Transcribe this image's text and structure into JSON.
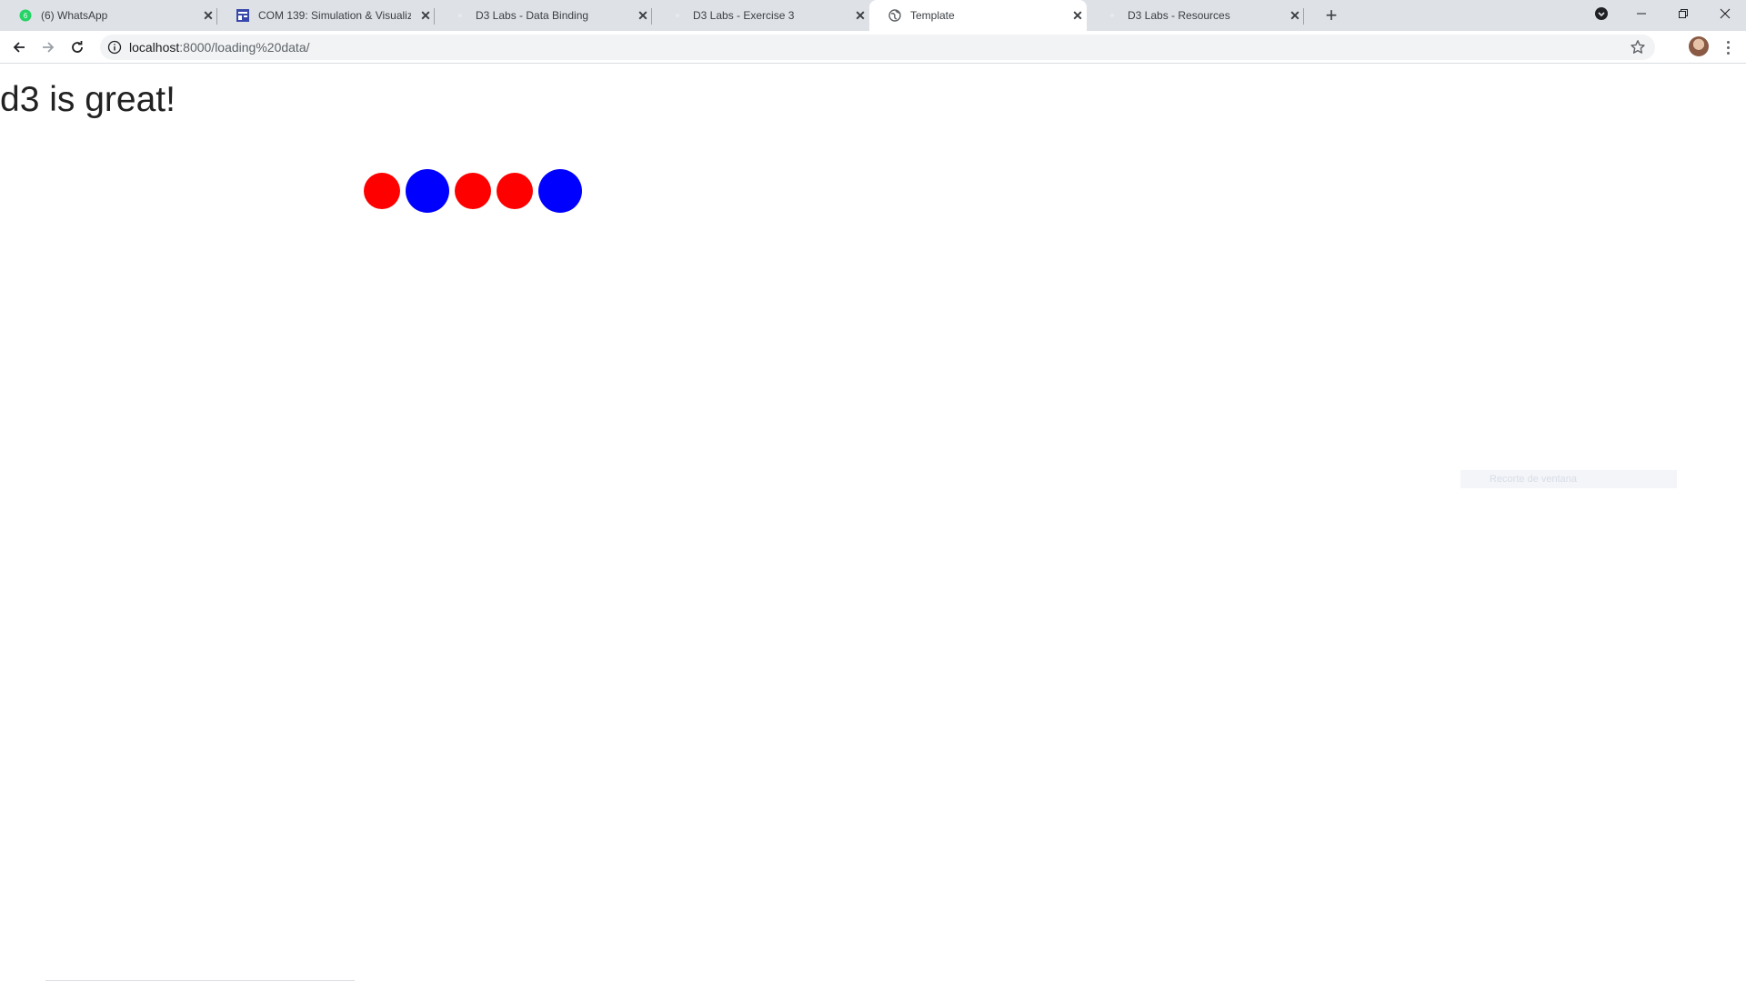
{
  "browser": {
    "tabs": [
      {
        "title": "(6) WhatsApp",
        "icon": "whatsapp-icon",
        "active": false
      },
      {
        "title": "COM 139: Simulation & Visualiza",
        "icon": "course-icon",
        "active": false
      },
      {
        "title": "D3 Labs - Data Binding",
        "icon": "page-icon",
        "active": false
      },
      {
        "title": "D3 Labs - Exercise 3",
        "icon": "page-icon",
        "active": false
      },
      {
        "title": "Template",
        "icon": "globe-icon",
        "active": true
      },
      {
        "title": "D3 Labs - Resources",
        "icon": "page-icon",
        "active": false
      }
    ],
    "url_host": "localhost",
    "url_path": ":8000/loading%20data/"
  },
  "page": {
    "heading": "d3 is great!",
    "circles": [
      {
        "color": "#ff0000",
        "size": "small"
      },
      {
        "color": "#0000ff",
        "size": "large"
      },
      {
        "color": "#ff0000",
        "size": "small"
      },
      {
        "color": "#ff0000",
        "size": "small"
      },
      {
        "color": "#0000ff",
        "size": "large"
      }
    ],
    "ghost_label": "Recorte de ventana"
  },
  "colors": {
    "tabstrip": "#dee1e6",
    "red": "#ff0000",
    "blue": "#0000ff"
  }
}
